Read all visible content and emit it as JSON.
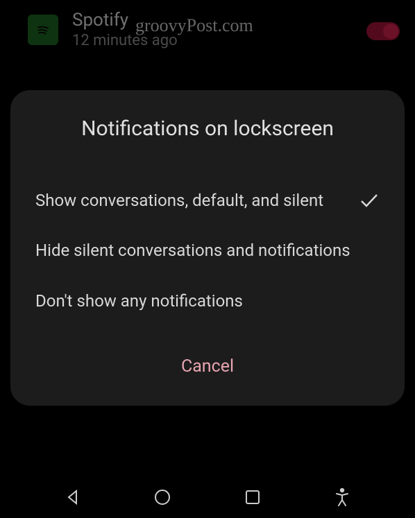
{
  "background_notification": {
    "app_name": "Spotify",
    "timestamp": "12 minutes ago"
  },
  "watermark": "groovyPost.com",
  "dialog": {
    "title": "Notifications on lockscreen",
    "options": [
      {
        "label": "Show conversations, default, and silent",
        "selected": true
      },
      {
        "label": "Hide silent conversations and notifications",
        "selected": false
      },
      {
        "label": "Don't show any notifications",
        "selected": false
      }
    ],
    "cancel_label": "Cancel"
  }
}
